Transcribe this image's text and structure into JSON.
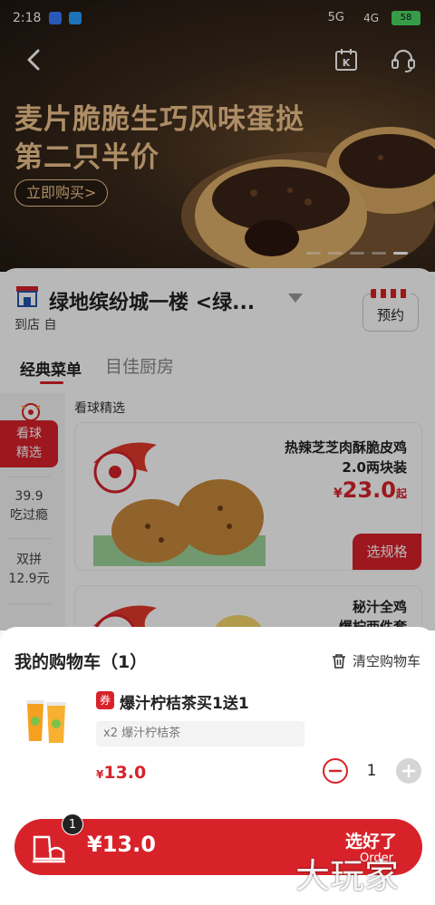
{
  "status_bar": {
    "time": "2:18",
    "signal": "5G",
    "network": "4G",
    "battery": "58"
  },
  "banner": {
    "title": "麦片脆脆生巧风味蛋挞",
    "subtitle": "第二只半价",
    "buy_label": "立即购买>",
    "slide_count": 5,
    "active_slide": 4
  },
  "store": {
    "name": "绿地缤纷城一楼 <绿...",
    "mode": "到店 自",
    "reserve_label": "预约"
  },
  "menu_tabs": {
    "classic": "经典菜单",
    "kitchen": "目佳厨房"
  },
  "sidebar": {
    "items": [
      {
        "label": "看球\n精选",
        "active": true
      },
      {
        "label": "39.9\n吃过瘾",
        "active": false
      },
      {
        "label": "双拼\n12.9元",
        "active": false
      }
    ]
  },
  "section_title": "看球精选",
  "products": [
    {
      "name_line1": "热辣芝芝肉酥脆皮鸡",
      "name_line2": "2.0两块装",
      "price": "23.0",
      "price_suffix": "起",
      "button": "选规格"
    },
    {
      "name_line1": "秘汁全鸡",
      "name_line2": "爆柠两件套"
    }
  ],
  "cart": {
    "title": "我的购物车（1）",
    "clear_label": "清空购物车",
    "coupon_tag": "券",
    "item_name": "爆汁柠桔茶买1送1",
    "item_detail": "x2 爆汁柠桔茶",
    "item_price": "13.0",
    "currency": "¥",
    "quantity": "1"
  },
  "checkout": {
    "count": "1",
    "total": "¥13.0",
    "label": "选好了",
    "sub_label": "Order"
  },
  "watermark": "大玩家",
  "colors": {
    "brand_red": "#d8222a",
    "promo_gold": "#f0c48c"
  }
}
